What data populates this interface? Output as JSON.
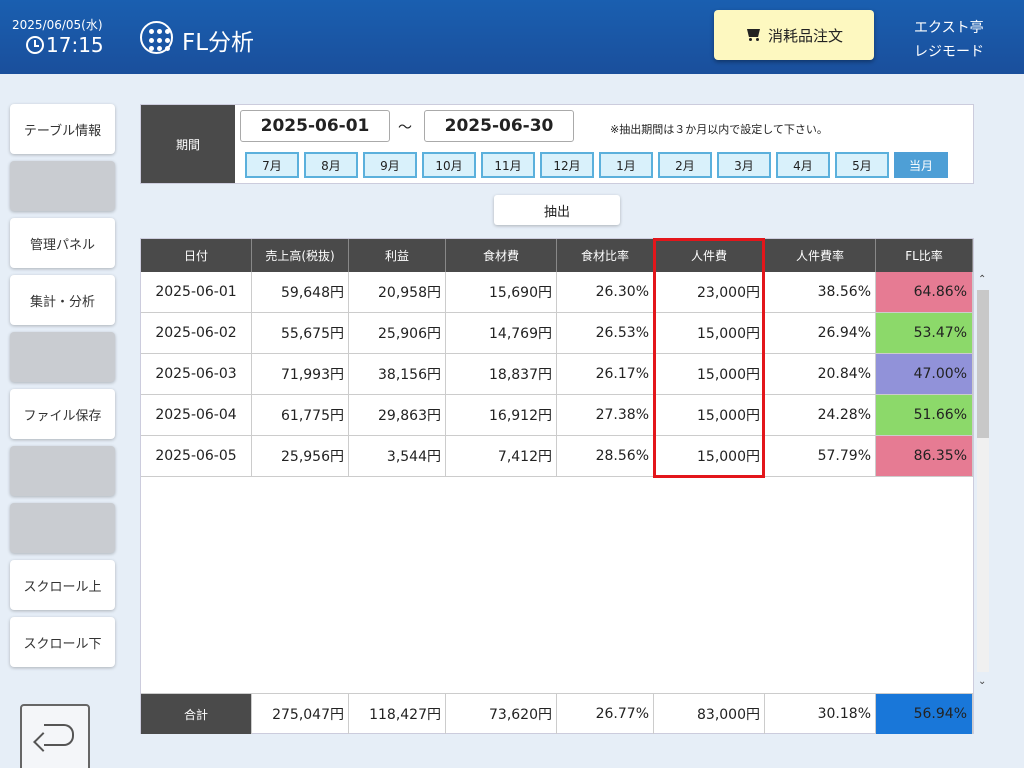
{
  "header": {
    "date": "2025/06/05(水)",
    "time": "17:15",
    "title": "FL分析",
    "order_button": "消耗品注文",
    "store_name": "エクスト亭",
    "mode": "レジモード"
  },
  "sidebar": {
    "items": [
      {
        "label": "テーブル情報",
        "enabled": true
      },
      {
        "label": "",
        "enabled": false
      },
      {
        "label": "管理パネル",
        "enabled": true
      },
      {
        "label": "集計・分析",
        "enabled": true
      },
      {
        "label": "",
        "enabled": false
      },
      {
        "label": "ファイル保存",
        "enabled": true
      },
      {
        "label": "",
        "enabled": false
      },
      {
        "label": "",
        "enabled": false
      },
      {
        "label": "スクロール上",
        "enabled": true
      },
      {
        "label": "スクロール下",
        "enabled": true
      }
    ]
  },
  "period": {
    "label": "期間",
    "from": "2025-06-01",
    "separator": "～",
    "to": "2025-06-30",
    "note": "※抽出期間は３か月以内で設定して下さい。",
    "months": [
      "7月",
      "8月",
      "9月",
      "10月",
      "11月",
      "12月",
      "1月",
      "2月",
      "3月",
      "4月",
      "5月",
      "当月"
    ],
    "extract_button": "抽出"
  },
  "table": {
    "headers": [
      "日付",
      "売上高(税抜)",
      "利益",
      "食材費",
      "食材比率",
      "人件費",
      "人件費率",
      "FL比率"
    ],
    "rows": [
      [
        "2025-06-01",
        "59,648円",
        "20,958円",
        "15,690円",
        "26.30%",
        "23,000円",
        "38.56%",
        "64.86%"
      ],
      [
        "2025-06-02",
        "55,675円",
        "25,906円",
        "14,769円",
        "26.53%",
        "15,000円",
        "26.94%",
        "53.47%"
      ],
      [
        "2025-06-03",
        "71,993円",
        "38,156円",
        "18,837円",
        "26.17%",
        "15,000円",
        "20.84%",
        "47.00%"
      ],
      [
        "2025-06-04",
        "61,775円",
        "29,863円",
        "16,912円",
        "27.38%",
        "15,000円",
        "24.28%",
        "51.66%"
      ],
      [
        "2025-06-05",
        "25,956円",
        "3,544円",
        "7,412円",
        "28.56%",
        "15,000円",
        "57.79%",
        "86.35%"
      ]
    ],
    "fl_colors": [
      "#e67b93",
      "#8cd96a",
      "#9192d9",
      "#8cd96a",
      "#e67b93"
    ],
    "total": [
      "合計",
      "275,047円",
      "118,427円",
      "73,620円",
      "26.77%",
      "83,000円",
      "30.18%",
      "56.94%"
    ],
    "total_fl_color": "#1977d9"
  }
}
